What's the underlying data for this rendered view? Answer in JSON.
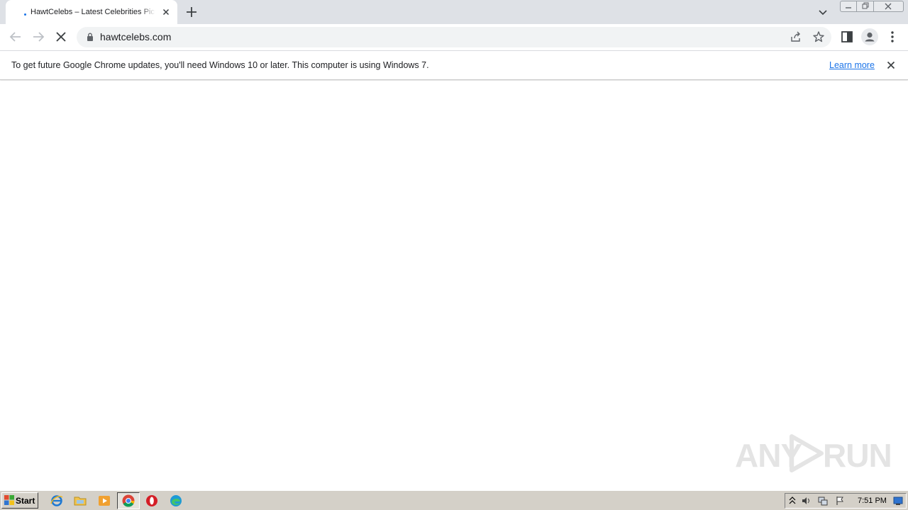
{
  "browser": {
    "tab": {
      "title": "HawtCelebs – Latest Celebrities Pictures",
      "loading": true
    },
    "address_bar": {
      "url": "hawtcelebs.com"
    },
    "toolbar_icons": [
      "back-arrow-icon",
      "forward-arrow-icon",
      "stop-loading-icon",
      "lock-icon",
      "share-icon",
      "star-icon",
      "side-panel-icon",
      "profile-icon",
      "kebab-menu-icon"
    ]
  },
  "infobar": {
    "message": "To get future Google Chrome updates, you'll need Windows 10 or later. This computer is using Windows 7.",
    "link": "Learn more"
  },
  "watermark": {
    "text_left": "ANY",
    "text_right": "RUN"
  },
  "taskbar": {
    "start_label": "Start",
    "apps": [
      "internet-explorer-icon",
      "file-explorer-icon",
      "media-player-icon",
      "chrome-icon",
      "opera-icon",
      "edge-icon"
    ],
    "active_app": "chrome-icon",
    "clock": "7:51 PM"
  },
  "colors": {
    "accent": "#1a73e8",
    "tabstrip": "#dee1e6",
    "omnibox": "#f1f3f4",
    "taskbar": "#d4d0c8"
  }
}
